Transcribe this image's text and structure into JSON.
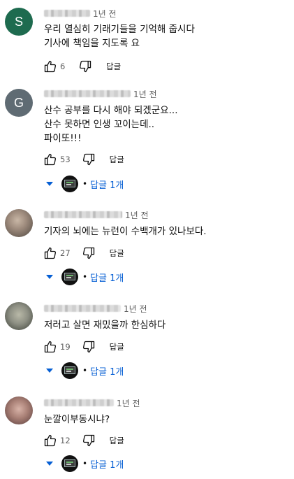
{
  "comments": [
    {
      "avatar_letter": "S",
      "avatar_color": "#1e6b4f",
      "time": "1년 전",
      "text": "우리 열심히 기래기들을 기억해 줍시다\n기사에 책임을 지도록 요",
      "likes": "6",
      "reply_label": "답글",
      "replies_label": ""
    },
    {
      "avatar_letter": "G",
      "avatar_color": "#5f6b73",
      "time": "1년 전",
      "text": "산수 공부를 다시 해야 되겠군요...\n산수 못하면 인생 꼬이는데..\n파이또!!!",
      "likes": "53",
      "reply_label": "답글",
      "replies_label": "답글 1개"
    },
    {
      "avatar_letter": "",
      "avatar_color": "#8c7b6e",
      "time": "1년 전",
      "text": "기자의 뇌에는 뉴런이 수백개가 있나보다.",
      "likes": "27",
      "reply_label": "답글",
      "replies_label": "답글 1개"
    },
    {
      "avatar_letter": "",
      "avatar_color": "#8d8f83",
      "time": "1년 전",
      "text": "저러고 살면 재밌을까 한심하다",
      "likes": "19",
      "reply_label": "답글",
      "replies_label": "답글 1개"
    },
    {
      "avatar_letter": "",
      "avatar_color": "#a77e74",
      "time": "1년 전",
      "text": "눈깔이부동시냐?",
      "likes": "12",
      "reply_label": "답글",
      "replies_label": "답글 1개"
    }
  ],
  "icons": {
    "like": "thumb-up-icon",
    "dislike": "thumb-down-icon",
    "expand": "caret-down-icon"
  },
  "colors": {
    "link_blue": "#065fd4",
    "secondary_text": "#606060"
  }
}
